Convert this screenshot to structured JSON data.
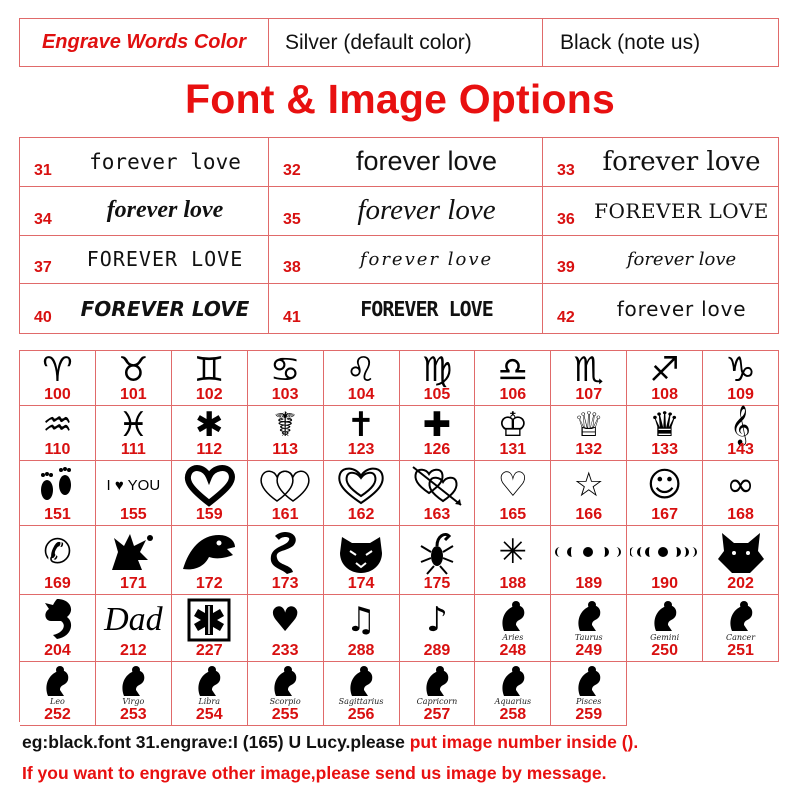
{
  "engrave_color": {
    "label": "Engrave Words Color",
    "option_silver": "Silver (default color)",
    "option_black": "Black (note us)"
  },
  "heading": "Font & Image Options",
  "fonts": [
    {
      "number": "31",
      "sample": "forever love"
    },
    {
      "number": "32",
      "sample": "forever love"
    },
    {
      "number": "33",
      "sample": "forever love"
    },
    {
      "number": "34",
      "sample": "forever love"
    },
    {
      "number": "35",
      "sample": "forever love"
    },
    {
      "number": "36",
      "sample": "FOREVER LOVE"
    },
    {
      "number": "37",
      "sample": "FOREVER LOVE"
    },
    {
      "number": "38",
      "sample": "forever love"
    },
    {
      "number": "39",
      "sample": "forever love"
    },
    {
      "number": "40",
      "sample": "FOREVER LOVE"
    },
    {
      "number": "41",
      "sample": "FOREVER LOVE"
    },
    {
      "number": "42",
      "sample": "forever love"
    }
  ],
  "images": [
    {
      "number": "100",
      "icon": "aries-icon",
      "glyph": "♈"
    },
    {
      "number": "101",
      "icon": "taurus-icon",
      "glyph": "♉"
    },
    {
      "number": "102",
      "icon": "gemini-icon",
      "glyph": "♊"
    },
    {
      "number": "103",
      "icon": "cancer-icon",
      "glyph": "♋"
    },
    {
      "number": "104",
      "icon": "leo-icon",
      "glyph": "♌"
    },
    {
      "number": "105",
      "icon": "virgo-icon",
      "glyph": "♍"
    },
    {
      "number": "106",
      "icon": "libra-icon",
      "glyph": "♎"
    },
    {
      "number": "107",
      "icon": "scorpio-icon",
      "glyph": "♏"
    },
    {
      "number": "108",
      "icon": "sagittarius-icon",
      "glyph": "♐"
    },
    {
      "number": "109",
      "icon": "capricorn-icon",
      "glyph": "♑"
    },
    {
      "number": "110",
      "icon": "aquarius-icon",
      "glyph": "♒"
    },
    {
      "number": "111",
      "icon": "pisces-icon",
      "glyph": "♓"
    },
    {
      "number": "112",
      "icon": "star-of-life-icon",
      "glyph": "✱"
    },
    {
      "number": "113",
      "icon": "caduceus-icon",
      "glyph": "☤"
    },
    {
      "number": "123",
      "icon": "latin-cross-icon",
      "glyph": "✝"
    },
    {
      "number": "126",
      "icon": "cross-icon",
      "glyph": "✚"
    },
    {
      "number": "131",
      "icon": "king-crown-icon",
      "glyph": "♔"
    },
    {
      "number": "132",
      "icon": "queen-crown-icon",
      "glyph": "♕"
    },
    {
      "number": "133",
      "icon": "tiara-icon",
      "glyph": "♛"
    },
    {
      "number": "143",
      "icon": "treble-clef-icon",
      "glyph": "𝄞"
    },
    {
      "number": "151",
      "icon": "footprints-icon",
      "glyph": ""
    },
    {
      "number": "155",
      "icon": "i-love-you-icon",
      "glyph": "",
      "text": "I ♥ YOU"
    },
    {
      "number": "159",
      "icon": "heart-brush-icon",
      "glyph": ""
    },
    {
      "number": "161",
      "icon": "linked-hearts-icon",
      "glyph": ""
    },
    {
      "number": "162",
      "icon": "double-heart-icon",
      "glyph": ""
    },
    {
      "number": "163",
      "icon": "hearts-arrow-icon",
      "glyph": ""
    },
    {
      "number": "165",
      "icon": "heart-outline-icon",
      "glyph": "♡"
    },
    {
      "number": "166",
      "icon": "star-outline-icon",
      "glyph": "☆"
    },
    {
      "number": "167",
      "icon": "smiley-icon",
      "glyph": "☺"
    },
    {
      "number": "168",
      "icon": "infinity-icon",
      "glyph": "∞"
    },
    {
      "number": "169",
      "icon": "phone-icon",
      "glyph": "✆"
    },
    {
      "number": "171",
      "icon": "howling-wolf-icon",
      "glyph": ""
    },
    {
      "number": "172",
      "icon": "eagle-head-icon",
      "glyph": ""
    },
    {
      "number": "173",
      "icon": "dragon-icon",
      "glyph": ""
    },
    {
      "number": "174",
      "icon": "tiger-icon",
      "glyph": ""
    },
    {
      "number": "175",
      "icon": "scorpion-icon",
      "glyph": ""
    },
    {
      "number": "188",
      "icon": "star-of-life-outline-icon",
      "glyph": "✳"
    },
    {
      "number": "189",
      "icon": "moon-phases-icon",
      "glyph": ""
    },
    {
      "number": "190",
      "icon": "moon-phases-long-icon",
      "glyph": ""
    },
    {
      "number": "202",
      "icon": "wolf-head-icon",
      "glyph": ""
    },
    {
      "number": "204",
      "icon": "dragon-coil-icon",
      "glyph": ""
    },
    {
      "number": "212",
      "icon": "dad-text-icon",
      "glyph": "",
      "text": "Dad"
    },
    {
      "number": "227",
      "icon": "medical-badge-icon",
      "glyph": ""
    },
    {
      "number": "233",
      "icon": "heart-filled-icon",
      "glyph": "♥"
    },
    {
      "number": "288",
      "icon": "beamed-notes-icon",
      "glyph": "♫"
    },
    {
      "number": "289",
      "icon": "eighth-note-icon",
      "glyph": "♪"
    },
    {
      "number": "248",
      "icon": "aries-figure-icon",
      "glyph": "",
      "label": "Aries"
    },
    {
      "number": "249",
      "icon": "taurus-figure-icon",
      "glyph": "",
      "label": "Taurus"
    },
    {
      "number": "250",
      "icon": "gemini-figure-icon",
      "glyph": "",
      "label": "Gemini"
    },
    {
      "number": "251",
      "icon": "cancer-figure-icon",
      "glyph": "",
      "label": "Cancer"
    },
    {
      "number": "252",
      "icon": "leo-figure-icon",
      "glyph": "",
      "label": "Leo"
    },
    {
      "number": "253",
      "icon": "virgo-figure-icon",
      "glyph": "",
      "label": "Virgo"
    },
    {
      "number": "254",
      "icon": "libra-figure-icon",
      "glyph": "",
      "label": "Libra"
    },
    {
      "number": "255",
      "icon": "scorpio-figure-icon",
      "glyph": "",
      "label": "Scorpio"
    },
    {
      "number": "256",
      "icon": "sagittarius-figure-icon",
      "glyph": "",
      "label": "Sagittarius"
    },
    {
      "number": "257",
      "icon": "capricorn-figure-icon",
      "glyph": "",
      "label": "Capricorn"
    },
    {
      "number": "258",
      "icon": "aquarius-figure-icon",
      "glyph": "",
      "label": "Aquarius"
    },
    {
      "number": "259",
      "icon": "pisces-figure-icon",
      "glyph": "",
      "label": "Pisces"
    }
  ],
  "example_note": {
    "black_part": "eg:black.font 31.engrave:I (165) U Lucy.please ",
    "red_part": "put image number inside ()."
  },
  "other_image_note": "If you want to engrave other image,please send us image by message.",
  "colors": {
    "accent_red": "#e81010",
    "grid_line": "#e06a6a",
    "text": "#111111"
  }
}
